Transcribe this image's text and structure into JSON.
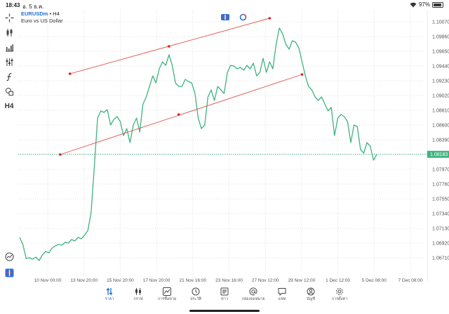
{
  "status_bar": {
    "time": "18:43",
    "date": "อ. 5 ธ.ค.",
    "battery": "97%"
  },
  "symbol": {
    "name": "EURUSDm",
    "timeframe": "H4",
    "description": "Euro vs US Dollar"
  },
  "toolbar": {
    "timeframe_label": "H4"
  },
  "chart_data": {
    "type": "line",
    "price_axis": [
      "1.10070",
      "1.09860",
      "1.09650",
      "1.09440",
      "1.09230",
      "1.09020",
      "1.08810",
      "1.08600",
      "1.08390",
      "1.08180",
      "1.07970",
      "1.07760",
      "1.07550",
      "1.07340",
      "1.07130",
      "1.06920",
      "1.06710"
    ],
    "current_price": "1.08183",
    "time_axis": [
      "10 Nov 00:00",
      "13 Nov 20:00",
      "15 Nov 20:00",
      "17 Nov 20:00",
      "21 Nov 16:00",
      "23 Nov 16:00",
      "27 Nov 12:00",
      "29 Nov 12:00",
      "1 Dec 12:00",
      "5 Dec 08:00",
      "7 Dec 08:00"
    ],
    "grid": true,
    "series": [
      {
        "color": "#3fb37f",
        "values": [
          1.07,
          1.069,
          1.067,
          1.0671,
          1.0669,
          1.0672,
          1.0667,
          1.0675,
          1.068,
          1.0678,
          1.0685,
          1.0688,
          1.069,
          1.0689,
          1.0693,
          1.0692,
          1.0697,
          1.0695,
          1.07,
          1.0698,
          1.0703,
          1.071,
          1.0735,
          1.08,
          1.087,
          1.088,
          1.0878,
          1.0882,
          1.086,
          1.0868,
          1.0872,
          1.0865,
          1.0845,
          1.0855,
          1.0835,
          1.086,
          1.087,
          1.085,
          1.089,
          1.09,
          1.0915,
          1.093,
          1.092,
          1.094,
          1.095,
          1.0945,
          1.096,
          1.0945,
          1.092,
          1.0915,
          1.0915,
          1.0925,
          1.0922,
          1.092,
          1.0905,
          1.087,
          1.0855,
          1.086,
          1.09,
          1.091,
          1.0895,
          1.0915,
          1.091,
          1.0905,
          1.0935,
          1.0945,
          1.0944,
          1.094,
          1.0942,
          1.0938,
          1.0945,
          1.094,
          1.0948,
          1.093,
          1.0935,
          1.0955,
          1.0935,
          1.095,
          1.094,
          1.0975,
          1.0998,
          1.099,
          1.0975,
          1.0968,
          1.098,
          1.0978,
          1.097,
          1.095,
          1.093,
          1.0915,
          1.091,
          1.09,
          1.0895,
          1.09,
          1.089,
          1.088,
          1.0885,
          1.0845,
          1.087,
          1.0875,
          1.0872,
          1.0865,
          1.0835,
          1.086,
          1.0858,
          1.0825,
          1.082,
          1.0835,
          1.083,
          1.081,
          1.0818
        ]
      }
    ],
    "channel_lines": [
      {
        "color": "#e05050",
        "from": {
          "time_index": 12.5,
          "price": 1.0818
        },
        "to": {
          "time_index": 87,
          "price": 1.0932
        },
        "mid_point": {
          "time_index": 49,
          "price": 1.0875
        }
      },
      {
        "color": "#e05050",
        "from": {
          "time_index": 15.5,
          "price": 1.0933
        },
        "to": {
          "time_index": 77,
          "price": 1.1012
        },
        "mid_point": {
          "time_index": 46,
          "price": 1.0972
        }
      }
    ]
  },
  "tabbar": {
    "tabs": [
      {
        "label": "ราคา",
        "icon": "quotes-icon",
        "active": true
      },
      {
        "label": "กราฟ",
        "icon": "chart-icon",
        "active": false
      },
      {
        "label": "การซื้อขาย",
        "icon": "trade-icon",
        "active": false
      },
      {
        "label": "ประวัติ",
        "icon": "history-icon",
        "active": false
      },
      {
        "label": "ข่าว",
        "icon": "news-icon",
        "active": false
      },
      {
        "label": "กล่องจดหมาย",
        "icon": "mailbox-icon",
        "active": false
      },
      {
        "label": "แชท",
        "icon": "chat-icon",
        "active": false
      },
      {
        "label": "บัญชี",
        "icon": "account-icon",
        "active": false
      },
      {
        "label": "การตั้งค่า",
        "icon": "settings-icon",
        "active": false
      }
    ]
  }
}
